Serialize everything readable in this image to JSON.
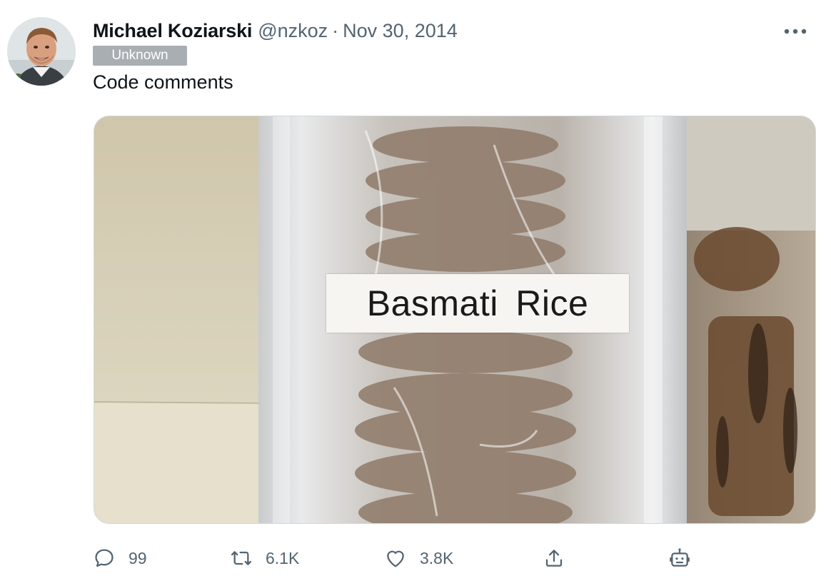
{
  "tweet": {
    "author_name": "Michael Koziarski",
    "handle": "@nzkoz",
    "separator": "·",
    "date": "Nov 30, 2014",
    "badge": "Unknown",
    "text": "Code comments",
    "media_label": "Basmati  Rice"
  },
  "actions": {
    "reply_count": "99",
    "retweet_count": "6.1K",
    "like_count": "3.8K"
  },
  "icons": [
    "more-icon",
    "reply-icon",
    "retweet-icon",
    "like-icon",
    "share-icon",
    "bot-icon"
  ],
  "colors": {
    "text": "#0f1419",
    "secondary": "#536471",
    "badge_bg": "#a9aeb3"
  }
}
